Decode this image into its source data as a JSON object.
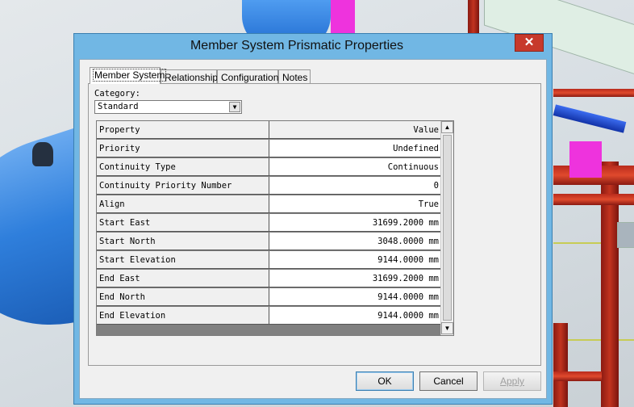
{
  "window": {
    "title": "Member System Prismatic Properties",
    "close_glyph": "✕"
  },
  "tabs": [
    {
      "label": "Member System",
      "active": true
    },
    {
      "label": "Relationship",
      "active": false
    },
    {
      "label": "Configuration",
      "active": false
    },
    {
      "label": "Notes",
      "active": false
    }
  ],
  "category": {
    "label": "Category:",
    "value": "Standard",
    "arrow": "▼"
  },
  "grid": {
    "header": {
      "property": "Property",
      "value": "Value"
    },
    "rows": [
      {
        "property": "Priority",
        "value": "Undefined"
      },
      {
        "property": "Continuity Type",
        "value": "Continuous"
      },
      {
        "property": "Continuity Priority Number",
        "value": "0"
      },
      {
        "property": "Align",
        "value": "True"
      },
      {
        "property": "Start East",
        "value": "31699.2000 mm"
      },
      {
        "property": "Start North",
        "value": "3048.0000 mm"
      },
      {
        "property": "Start Elevation",
        "value": "9144.0000 mm"
      },
      {
        "property": "End East",
        "value": "31699.2000 mm"
      },
      {
        "property": "End North",
        "value": "9144.0000 mm"
      },
      {
        "property": "End Elevation",
        "value": "9144.0000 mm"
      }
    ],
    "scroll_up": "▲",
    "scroll_down": "▼"
  },
  "buttons": {
    "ok": "OK",
    "cancel": "Cancel",
    "apply": "Apply"
  },
  "colors": {
    "titlebar": "#71b7e4",
    "close": "#c7392b"
  }
}
